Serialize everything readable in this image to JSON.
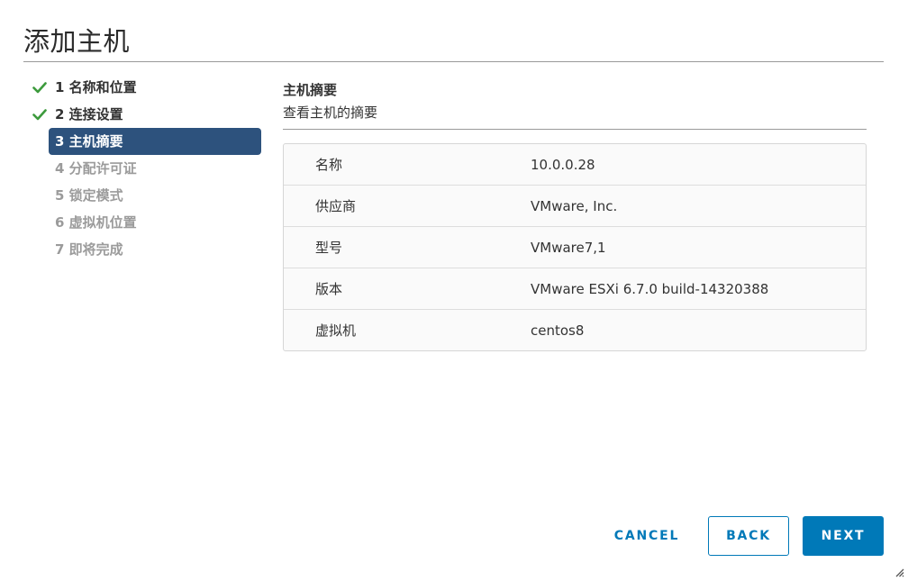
{
  "dialog": {
    "title": "添加主机"
  },
  "steps": [
    {
      "label": "1 名称和位置",
      "state": "done"
    },
    {
      "label": "2 连接设置",
      "state": "done"
    },
    {
      "label": "3 主机摘要",
      "state": "active"
    },
    {
      "label": "4 分配许可证",
      "state": "disabled"
    },
    {
      "label": "5 锁定模式",
      "state": "disabled"
    },
    {
      "label": "6 虚拟机位置",
      "state": "disabled"
    },
    {
      "label": "7 即将完成",
      "state": "disabled"
    }
  ],
  "main": {
    "heading": "主机摘要",
    "subheading": "查看主机的摘要",
    "summary": [
      {
        "key": "名称",
        "value": "10.0.0.28"
      },
      {
        "key": "供应商",
        "value": "VMware, Inc."
      },
      {
        "key": "型号",
        "value": "VMware7,1"
      },
      {
        "key": "版本",
        "value": "VMware ESXi 6.7.0 build-14320388"
      },
      {
        "key": "虚拟机",
        "value": "centos8"
      }
    ]
  },
  "footer": {
    "cancel_label": "CANCEL",
    "back_label": "BACK",
    "next_label": "NEXT"
  },
  "icons": {
    "check": "check-icon",
    "resize": "resize-handle-icon"
  },
  "colors": {
    "accent": "#0079b8",
    "active_step_bg": "#2d527d",
    "check_green": "#3c9a3c",
    "disabled_text": "#9b9b9b"
  }
}
